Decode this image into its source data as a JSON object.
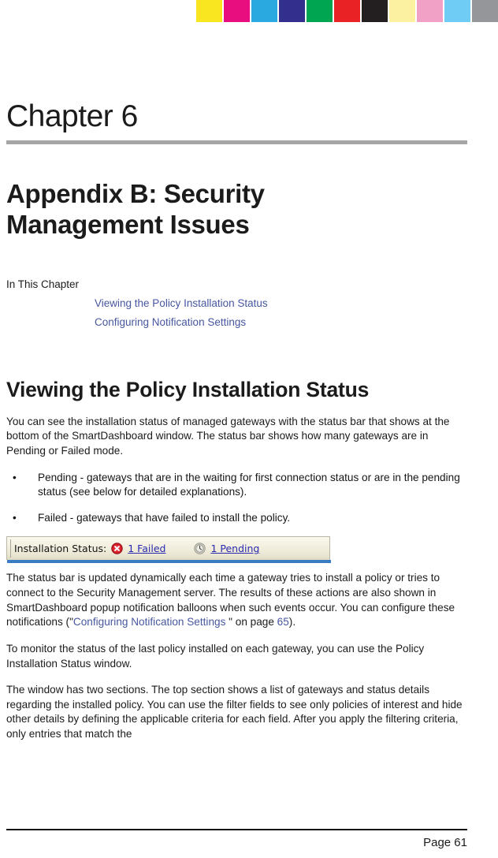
{
  "color_bar": {
    "name": "printer-calibration-bar",
    "swatches": [
      {
        "name": "yellow",
        "hex": "#f9e621"
      },
      {
        "name": "magenta",
        "hex": "#e80e7f"
      },
      {
        "name": "cyan",
        "hex": "#29a9e0"
      },
      {
        "name": "dark-blue",
        "hex": "#32308c"
      },
      {
        "name": "green",
        "hex": "#00a551"
      },
      {
        "name": "red",
        "hex": "#e92226"
      },
      {
        "name": "black",
        "hex": "#231f20"
      },
      {
        "name": "light-yellow",
        "hex": "#fcf1a0"
      },
      {
        "name": "pink",
        "hex": "#f2a1c6"
      },
      {
        "name": "light-blue",
        "hex": "#6fcdf5"
      },
      {
        "name": "gray",
        "hex": "#949699"
      }
    ]
  },
  "header": {
    "chapter_label": "Chapter 6",
    "doc_title": "Appendix B: Security Management Issues"
  },
  "in_this_chapter": {
    "label": "In This Chapter",
    "entries": [
      {
        "text": "Viewing the Policy Installation Status"
      },
      {
        "text": "Configuring Notification Settings"
      }
    ]
  },
  "section": {
    "title": "Viewing the Policy Installation Status",
    "paragraph_1": "You can see the installation status of managed gateways with the status bar that shows at the bottom of the SmartDashboard window. The status bar shows how many gateways are in Pending or Failed mode.",
    "bullets": [
      {
        "marker": "•",
        "text": "Pending - gateways that are in the waiting for first connection status or are in the pending status (see below for detailed explanations)."
      },
      {
        "marker": "•",
        "text": "Failed - gateways that have failed to install the policy."
      }
    ],
    "paragraph_2": {
      "part_1": "The status bar is updated dynamically each time a gateway tries to install a policy or tries to connect to the Security Management server. The results of these actions are also shown in SmartDashboard popup notification balloons when such events occur. You can configure these notifications (\"",
      "link_text": "Configuring Notification Settings",
      "part_2": "  \" on page ",
      "page_ref": "65",
      "part_3": ")."
    },
    "paragraph_3": "To monitor the status of the last policy installed on each gateway, you can use the Policy Installation Status window.",
    "paragraph_4": "The window has two sections. The top section shows a list of gateways and status details regarding the installed policy. You can use the filter fields to see only policies of interest and hide other details by defining the applicable criteria for each field. After you apply the filtering criteria, only entries that match the"
  },
  "status_bar_figure": {
    "label": "Installation Status:",
    "failed": {
      "icon": "error-circle-icon",
      "text": "1 Failed",
      "icon_color": "#d41e2a"
    },
    "pending": {
      "icon": "clock-icon",
      "text": "1 Pending",
      "icon_color": "#b5b5ad"
    },
    "link_color": "#2a2ab0"
  },
  "footer": {
    "page_label": "Page 61"
  }
}
